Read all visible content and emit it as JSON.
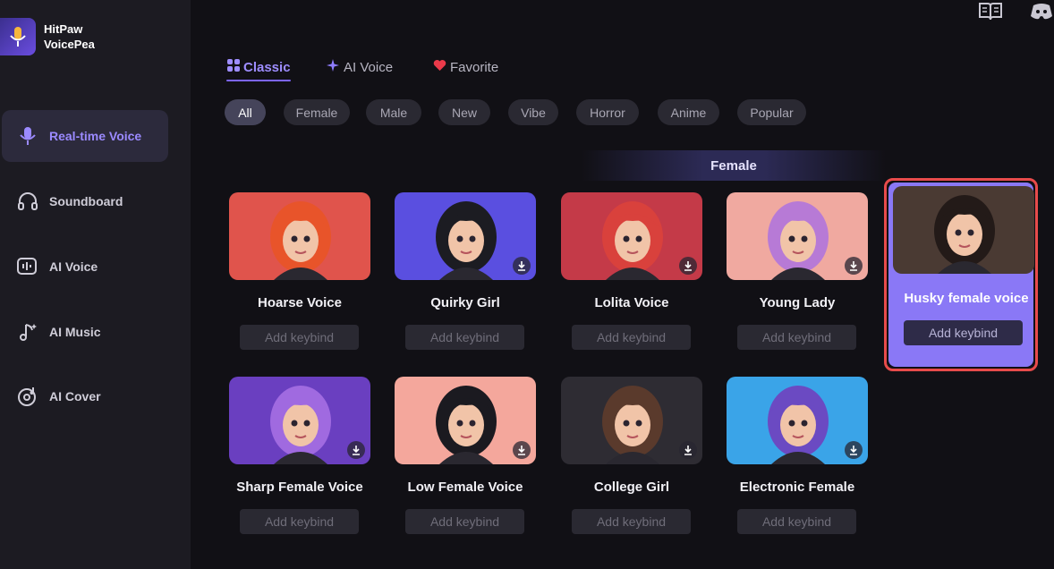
{
  "app": {
    "name_line1": "HitPaw",
    "name_line2": "VoicePea"
  },
  "sidebar": {
    "items": [
      {
        "label": "Real-time Voice",
        "icon": "microphone-icon",
        "active": true
      },
      {
        "label": "Soundboard",
        "icon": "headphones-icon",
        "active": false
      },
      {
        "label": "AI Voice",
        "icon": "ai-voice-icon",
        "active": false
      },
      {
        "label": "AI Music",
        "icon": "music-note-icon",
        "active": false
      },
      {
        "label": "AI Cover",
        "icon": "disc-icon",
        "active": false
      }
    ]
  },
  "tabs": [
    {
      "label": "Classic",
      "icon": "grid-icon",
      "active": true
    },
    {
      "label": "AI Voice",
      "icon": "sparkle-icon",
      "active": false
    },
    {
      "label": "Favorite",
      "icon": "heart-icon",
      "active": false
    }
  ],
  "filters": [
    "All",
    "Female",
    "Male",
    "New",
    "Vibe",
    "Horror",
    "Anime",
    "Popular"
  ],
  "active_filter": "All",
  "section": {
    "title": "Female"
  },
  "keybind_label": "Add keybind",
  "voices": [
    {
      "name": "Hoarse Voice",
      "bg": "#e0544c",
      "hair": "#e8542a",
      "download": false
    },
    {
      "name": "Quirky Girl",
      "bg": "#5a4fe0",
      "hair": "#1c1c22",
      "download": true
    },
    {
      "name": "Lolita Voice",
      "bg": "#c43a48",
      "hair": "#d9413c",
      "download": true
    },
    {
      "name": "Young Lady",
      "bg": "#f0a9a0",
      "hair": "#b77ad6",
      "download": true
    },
    {
      "name": "Husky female voice",
      "bg": "#4a3a33",
      "hair": "#231a18",
      "download": false,
      "selected": true
    },
    {
      "name": "Sharp Female Voice",
      "bg": "#6a3fc0",
      "hair": "#a06ae0",
      "download": true
    },
    {
      "name": "Low Female Voice",
      "bg": "#f4a79c",
      "hair": "#1b1a20",
      "download": true
    },
    {
      "name": "College Girl",
      "bg": "#2e2c33",
      "hair": "#5a3a2c",
      "download": true
    },
    {
      "name": "Electronic Female",
      "bg": "#3aa4e8",
      "hair": "#6b4ac2",
      "download": true
    }
  ],
  "colors": {
    "accent": "#7c65ff",
    "selected_card": "#8a78f6",
    "highlight_border": "#e84b4b"
  }
}
